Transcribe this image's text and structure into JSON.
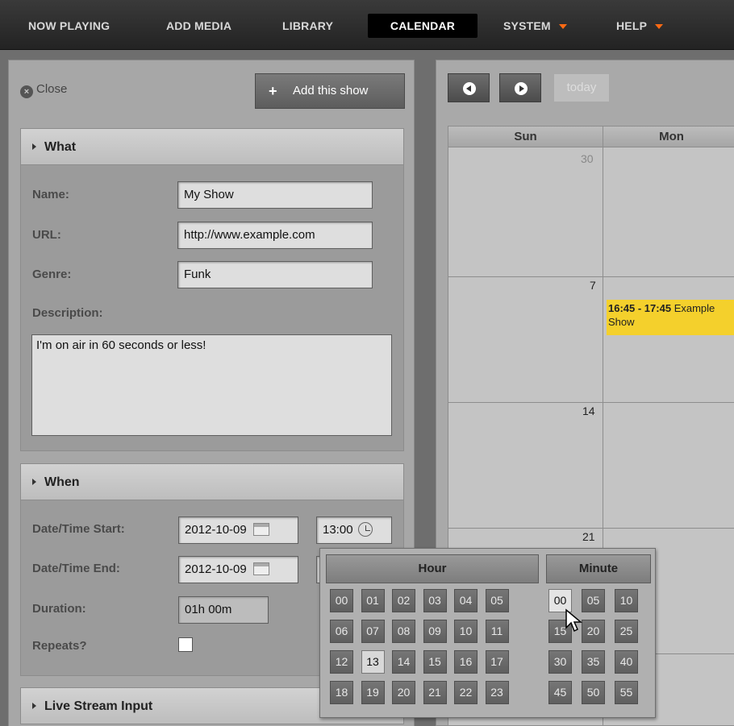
{
  "nav": {
    "items": [
      {
        "label": "NOW PLAYING"
      },
      {
        "label": "ADD MEDIA"
      },
      {
        "label": "LIBRARY"
      },
      {
        "label": "CALENDAR",
        "active": true
      },
      {
        "label": "SYSTEM",
        "dropdown": true
      },
      {
        "label": "HELP",
        "dropdown": true
      }
    ],
    "accent_color": "#ff6a13"
  },
  "form": {
    "close_label": "Close",
    "add_show_label": "Add this show",
    "what": {
      "title": "What",
      "name_label": "Name:",
      "name_value": "My Show",
      "url_label": "URL:",
      "url_value": "http://www.example.com",
      "genre_label": "Genre:",
      "genre_value": "Funk",
      "description_label": "Description:",
      "description_value": "I'm on air in 60 seconds or less!"
    },
    "when": {
      "title": "When",
      "start_label": "Date/Time Start:",
      "start_date": "2012-10-09",
      "start_time": "13:00",
      "end_label": "Date/Time End:",
      "end_date": "2012-10-09",
      "duration_label": "Duration:",
      "duration_value": "01h 00m",
      "repeats_label": "Repeats?",
      "repeats_checked": false
    },
    "live_stream": {
      "title": "Live Stream Input"
    }
  },
  "calendar": {
    "today_label": "today",
    "days": [
      "Sun",
      "Mon"
    ],
    "week_start_dates": [
      "30",
      "7",
      "14",
      "21"
    ],
    "event": {
      "time": "16:45 - 17:45",
      "title": "Example Show",
      "color": "#f4d02c"
    }
  },
  "time_picker": {
    "hour_label": "Hour",
    "minute_label": "Minute",
    "hours": [
      "00",
      "01",
      "02",
      "03",
      "04",
      "05",
      "06",
      "07",
      "08",
      "09",
      "10",
      "11",
      "12",
      "13",
      "14",
      "15",
      "16",
      "17",
      "18",
      "19",
      "20",
      "21",
      "22",
      "23"
    ],
    "minutes": [
      "00",
      "05",
      "10",
      "15",
      "20",
      "25",
      "30",
      "35",
      "40",
      "45",
      "50",
      "55"
    ],
    "selected_hour": "13",
    "selected_minute": "00"
  }
}
